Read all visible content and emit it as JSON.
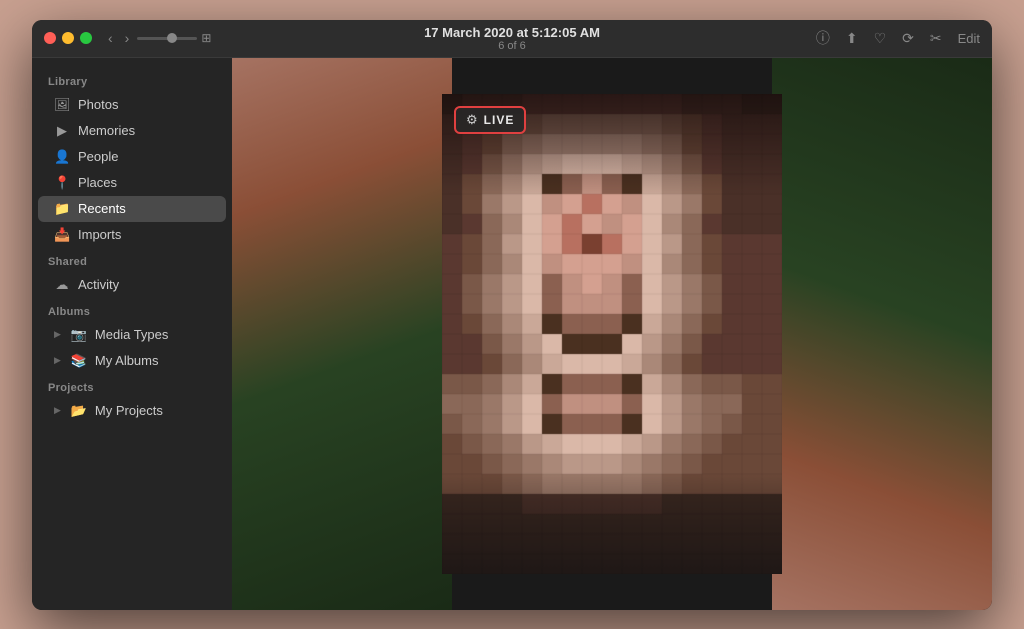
{
  "window": {
    "title": "17 March 2020 at 5:12:05 AM",
    "subtitle": "6 of 6"
  },
  "toolbar": {
    "back_label": "‹",
    "forward_label": "›",
    "info_icon": "ⓘ",
    "share_icon": "⬆",
    "heart_icon": "♡",
    "rotate_icon": "⟳",
    "tools_icon": "✂",
    "edit_label": "Edit"
  },
  "live_badge": {
    "icon": "⚙",
    "label": "LIVE"
  },
  "sidebar": {
    "library_label": "Library",
    "shared_label": "Shared",
    "albums_label": "Albums",
    "projects_label": "Projects",
    "items": [
      {
        "id": "photos",
        "label": "Photos",
        "icon": "🖼",
        "active": false
      },
      {
        "id": "memories",
        "label": "Memories",
        "icon": "▶",
        "active": false
      },
      {
        "id": "people",
        "label": "People",
        "icon": "👤",
        "active": false
      },
      {
        "id": "places",
        "label": "Places",
        "icon": "📍",
        "active": false
      },
      {
        "id": "recents",
        "label": "Recents",
        "icon": "📁",
        "active": true
      },
      {
        "id": "imports",
        "label": "Imports",
        "icon": "📥",
        "active": false
      },
      {
        "id": "activity",
        "label": "Activity",
        "icon": "☁",
        "active": false
      },
      {
        "id": "media-types",
        "label": "Media Types",
        "icon": "▶",
        "active": false,
        "expandable": true
      },
      {
        "id": "my-albums",
        "label": "My Albums",
        "icon": "▶",
        "active": false,
        "expandable": true
      },
      {
        "id": "my-projects",
        "label": "My Projects",
        "icon": "▶",
        "active": false,
        "expandable": true
      }
    ]
  },
  "colors": {
    "accent": "#e04040",
    "sidebar_bg": "#252525",
    "titlebar_bg": "#2d2d2d",
    "active_item": "#4a4a4a",
    "text_primary": "#e0e0e0",
    "text_secondary": "#888888"
  }
}
